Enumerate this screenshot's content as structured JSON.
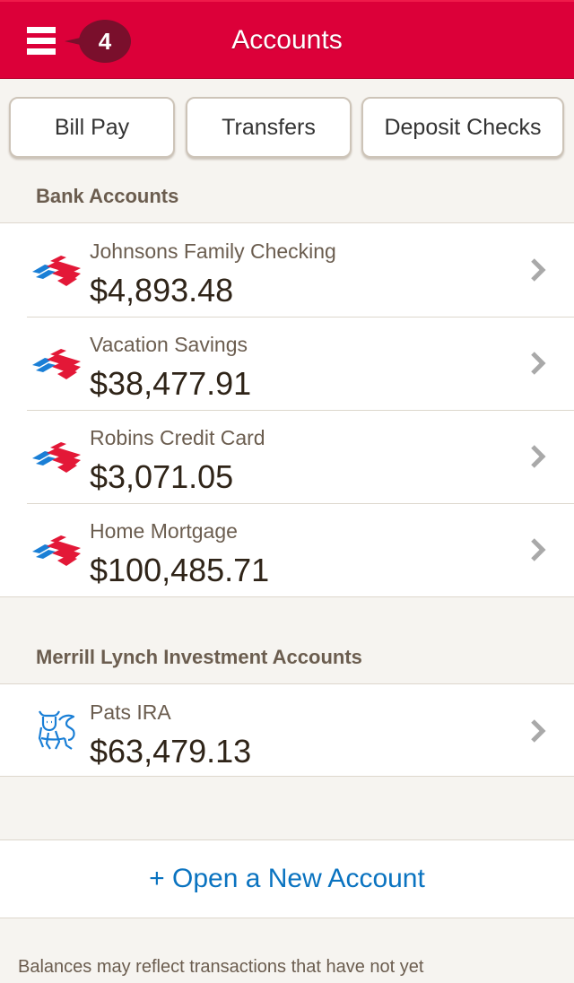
{
  "header": {
    "title": "Accounts",
    "menu_icon": "hamburger-menu-icon",
    "notification_count": "4"
  },
  "actions": [
    {
      "label": "Bill Pay"
    },
    {
      "label": "Transfers"
    },
    {
      "label": "Deposit Checks"
    }
  ],
  "sections": [
    {
      "title": "Bank Accounts",
      "icon": "bank-of-america-flag-logo",
      "accounts": [
        {
          "name": "Johnsons Family Checking",
          "balance": "$4,893.48"
        },
        {
          "name": "Vacation Savings",
          "balance": "$38,477.91"
        },
        {
          "name": "Robins Credit Card",
          "balance": "$3,071.05"
        },
        {
          "name": "Home Mortgage",
          "balance": "$100,485.71"
        }
      ]
    },
    {
      "title": "Merrill Lynch Investment Accounts",
      "icon": "merrill-lynch-bull-logo",
      "accounts": [
        {
          "name": "Pats IRA",
          "balance": "$63,479.13"
        }
      ]
    }
  ],
  "open_account": {
    "label": "+ Open a New Account"
  },
  "disclaimer": "Balances may reflect transactions that have not yet",
  "colors": {
    "brand_red": "#dc0039",
    "badge": "#7a0f2c",
    "link_blue": "#0a73c0",
    "boa_blue": "#1a7fd6",
    "boa_red": "#e31837"
  }
}
